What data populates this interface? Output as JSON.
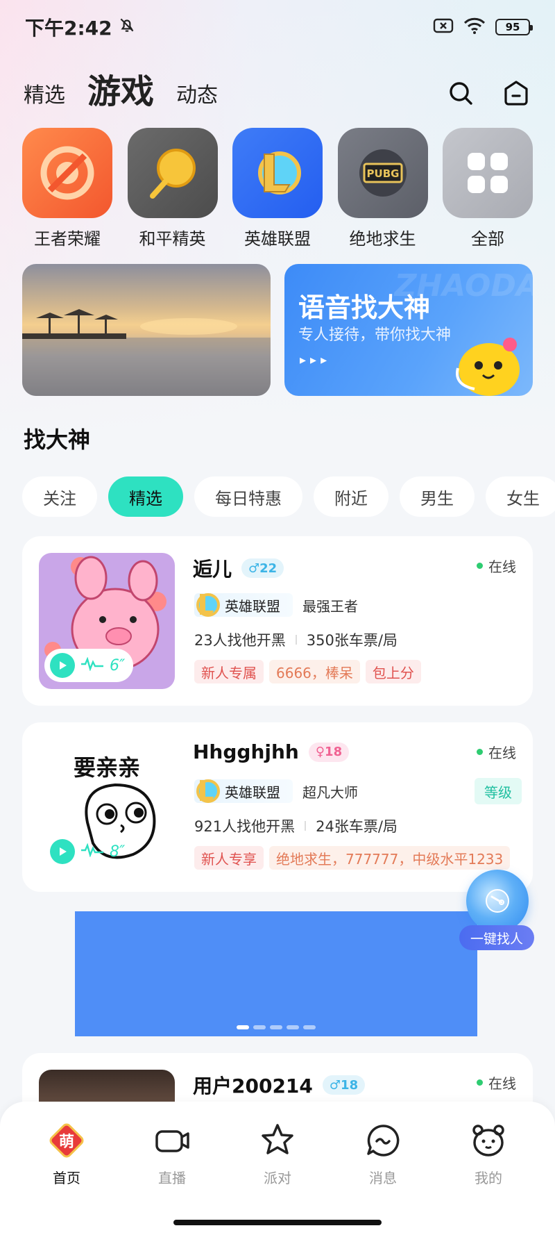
{
  "status": {
    "time": "下午2:42",
    "battery": "95"
  },
  "top_nav": {
    "tabs": [
      {
        "label": "精选",
        "active": false
      },
      {
        "label": "游戏",
        "active": true
      },
      {
        "label": "动态",
        "active": false
      }
    ]
  },
  "games": [
    {
      "label": "王者荣耀",
      "icon": "honor-of-kings-icon"
    },
    {
      "label": "和平精英",
      "icon": "peace-elite-icon"
    },
    {
      "label": "英雄联盟",
      "icon": "league-of-legends-icon"
    },
    {
      "label": "绝地求生",
      "icon": "pubg-icon",
      "icon_text": "PUBG"
    },
    {
      "label": "全部",
      "icon": "all-apps-icon"
    }
  ],
  "banners": {
    "voice": {
      "title": "语音找大神",
      "subtitle": "专人接待，带你找大神",
      "arrows": "▸▸▸",
      "watermark": "ZHAODA"
    }
  },
  "section_title": "找大神",
  "chips": [
    {
      "label": "关注",
      "active": false
    },
    {
      "label": "精选",
      "active": true
    },
    {
      "label": "每日特惠",
      "active": false
    },
    {
      "label": "附近",
      "active": false
    },
    {
      "label": "男生",
      "active": false
    },
    {
      "label": "女生",
      "active": false
    }
  ],
  "cards": [
    {
      "name": "逅儿",
      "gender_symbol": "♂",
      "age": "22",
      "online": "在线",
      "game": "英雄联盟",
      "rank": "最强王者",
      "stat1": "23人找他开黑",
      "stat2": "350张车票/局",
      "voice": "6″",
      "tags": [
        "新人专属",
        "6666，棒呆",
        "包上分"
      ]
    },
    {
      "name": "Hhgghjhh",
      "gender_symbol": "♀",
      "age": "18",
      "online": "在线",
      "game": "英雄联盟",
      "rank": "超凡大师",
      "level": "等级",
      "stat1": "921人找他开黑",
      "stat2": "24张车票/局",
      "voice": "8″",
      "sticker_text": "要亲亲",
      "tags": [
        "新人专享",
        "绝地求生，777777，中级水平1233"
      ]
    },
    {
      "name": "用户200214",
      "gender_symbol": "♂",
      "age": "18",
      "online": "在线"
    }
  ],
  "float_button": {
    "label": "一键找人"
  },
  "bottom_nav": [
    {
      "label": "首页",
      "active": true,
      "icon": "home-meng-icon",
      "icon_text": "萌"
    },
    {
      "label": "直播",
      "active": false,
      "icon": "live-camera-icon"
    },
    {
      "label": "派对",
      "active": false,
      "icon": "party-star-icon"
    },
    {
      "label": "消息",
      "active": false,
      "icon": "message-bubble-icon"
    },
    {
      "label": "我的",
      "active": false,
      "icon": "profile-bear-icon"
    }
  ],
  "colors": {
    "accent": "#2ee1c1",
    "voice_banner": "#4f97fa",
    "ad_banner": "#4f8ef7"
  }
}
